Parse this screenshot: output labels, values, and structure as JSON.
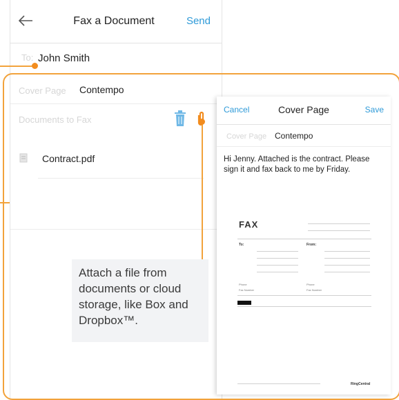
{
  "header": {
    "title": "Fax a Document",
    "send_label": "Send"
  },
  "form": {
    "to_placeholder": "To:",
    "recipient": "John Smith",
    "cover_page_label": "Cover Page",
    "cover_page_value": "Contempo",
    "documents_label": "Documents to Fax",
    "document_name": "Contract.pdf"
  },
  "caption": "Attach a file from documents or cloud storage, like Box and Dropbox™.",
  "cover_panel": {
    "cancel_label": "Cancel",
    "title": "Cover Page",
    "save_label": "Save",
    "cover_page_label": "Cover Page",
    "cover_page_value": "Contempo",
    "message": "Hi Jenny.  Attached is the contract. Please sign it and fax back to me by Friday."
  },
  "fax_preview": {
    "title": "FAX",
    "to_label": "To:",
    "from_label": "From:",
    "phone_label": "Phone",
    "fax_number_label": "Fax Number",
    "brand": "RingCentral"
  },
  "colors": {
    "accent": "#2e9ad8",
    "callout": "#f2a23a"
  },
  "icons": [
    "back-arrow-icon",
    "trash-icon",
    "paperclip-icon",
    "document-icon"
  ]
}
